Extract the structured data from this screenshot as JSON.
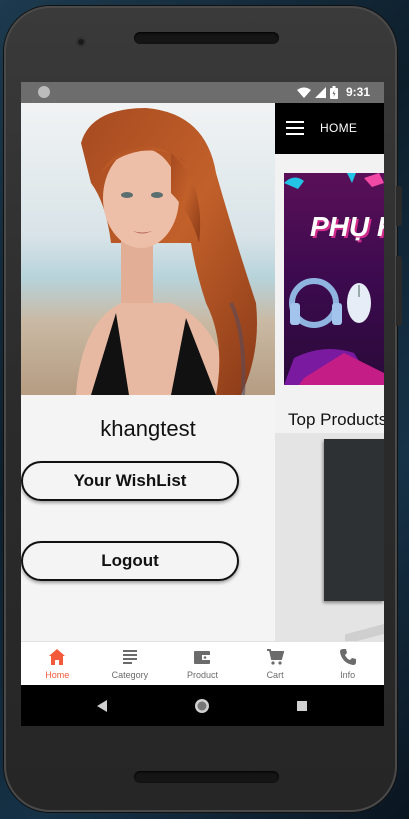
{
  "status_bar": {
    "time": "9:31"
  },
  "drawer": {
    "username": "khangtest",
    "wishlist_label": "Your WishList",
    "logout_label": "Logout"
  },
  "app_bar": {
    "title": "HOME"
  },
  "banner": {
    "text": "PHỤ K"
  },
  "section": {
    "title": "Top Products"
  },
  "bottom_nav": {
    "items": [
      {
        "label": "Home",
        "icon": "home-icon",
        "active": true
      },
      {
        "label": "Category",
        "icon": "list-icon",
        "active": false
      },
      {
        "label": "Product",
        "icon": "wallet-icon",
        "active": false
      },
      {
        "label": "Cart",
        "icon": "cart-icon",
        "active": false
      },
      {
        "label": "Info",
        "icon": "phone-icon",
        "active": false
      }
    ]
  },
  "colors": {
    "accent": "#f15a3a",
    "app_bar": "#000000",
    "drawer_bg": "#f4f4f4"
  }
}
